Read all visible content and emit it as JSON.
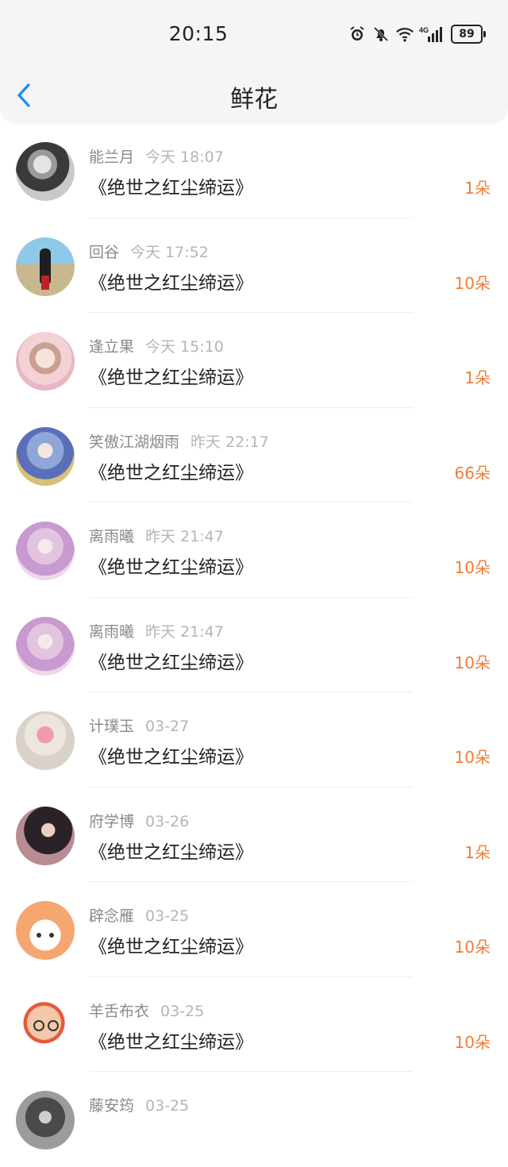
{
  "status_bar": {
    "time": "20:15",
    "battery": "89"
  },
  "header": {
    "title": "鲜花"
  },
  "items": [
    {
      "name": "能兰月",
      "time": "今天 18:07",
      "book": "《绝世之红尘缔运》",
      "amount": "1朵"
    },
    {
      "name": "回谷",
      "time": "今天 17:52",
      "book": "《绝世之红尘缔运》",
      "amount": "10朵"
    },
    {
      "name": "逢立果",
      "time": "今天 15:10",
      "book": "《绝世之红尘缔运》",
      "amount": "1朵"
    },
    {
      "name": "笑傲江湖烟雨",
      "time": "昨天 22:17",
      "book": "《绝世之红尘缔运》",
      "amount": "66朵"
    },
    {
      "name": "离雨曦",
      "time": "昨天 21:47",
      "book": "《绝世之红尘缔运》",
      "amount": "10朵"
    },
    {
      "name": "离雨曦",
      "time": "昨天 21:47",
      "book": "《绝世之红尘缔运》",
      "amount": "10朵"
    },
    {
      "name": "计璞玉",
      "time": "03-27",
      "book": "《绝世之红尘缔运》",
      "amount": "10朵"
    },
    {
      "name": "府学博",
      "time": "03-26",
      "book": "《绝世之红尘缔运》",
      "amount": "1朵"
    },
    {
      "name": "辟念雁",
      "time": "03-25",
      "book": "《绝世之红尘缔运》",
      "amount": "10朵"
    },
    {
      "name": "羊舌布衣",
      "time": "03-25",
      "book": "《绝世之红尘缔运》",
      "amount": "10朵"
    },
    {
      "name": "藤安筠",
      "time": "03-25",
      "book": "",
      "amount": ""
    }
  ],
  "colors": {
    "accent": "#f07d36",
    "back": "#1a8cf0"
  },
  "icons": [
    "alarm-icon",
    "mute-bell-icon",
    "wifi-icon",
    "signal-4g-icon",
    "battery-icon",
    "back-chevron-icon"
  ]
}
